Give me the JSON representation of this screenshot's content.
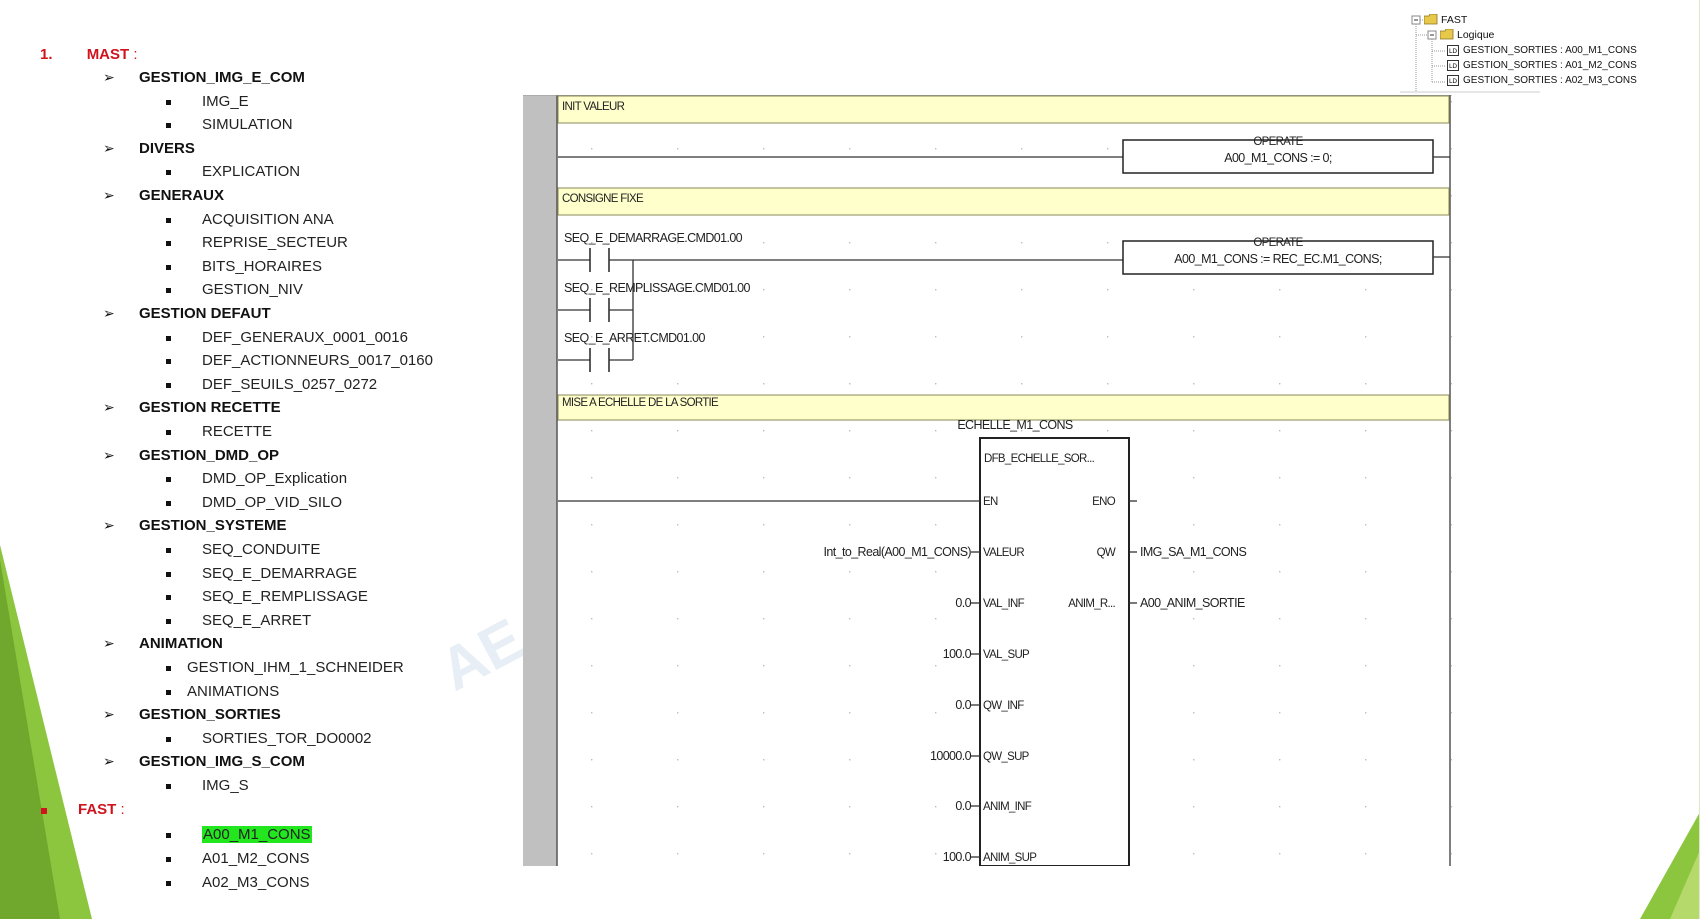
{
  "outline": {
    "mast": {
      "number": "1.",
      "title": "MAST",
      "colon": " :"
    },
    "groups": [
      {
        "name": "GESTION_IMG_E_COM",
        "items": [
          "IMG_E",
          "SIMULATION"
        ]
      },
      {
        "name": "DIVERS",
        "items": [
          "EXPLICATION"
        ]
      },
      {
        "name": "GENERAUX",
        "items": [
          "ACQUISITION ANA",
          "REPRISE_SECTEUR",
          "BITS_HORAIRES",
          "GESTION_NIV"
        ]
      },
      {
        "name": "GESTION DEFAUT",
        "items": [
          "DEF_GENERAUX_0001_0016",
          "DEF_ACTIONNEURS_0017_0160",
          "DEF_SEUILS_0257_0272"
        ]
      },
      {
        "name": "GESTION RECETTE",
        "items": [
          "RECETTE"
        ]
      },
      {
        "name": "GESTION_DMD_OP",
        "items": [
          "DMD_OP_Explication",
          "DMD_OP_VID_SILO"
        ]
      },
      {
        "name": "GESTION_SYSTEME",
        "items": [
          "SEQ_CONDUITE",
          "SEQ_E_DEMARRAGE",
          "SEQ_E_REMPLISSAGE",
          "SEQ_E_ARRET"
        ]
      },
      {
        "name": "ANIMATION",
        "items": [
          "GESTION_IHM_1_SCHNEIDER",
          "ANIMATIONS"
        ]
      },
      {
        "name": "GESTION_SORTIES",
        "items": [
          "SORTIES_TOR_DO0002"
        ]
      },
      {
        "name": "GESTION_IMG_S_COM",
        "items": [
          "IMG_S"
        ]
      }
    ],
    "fast": {
      "title": "FAST",
      "colon": " :",
      "items": [
        "A00_M1_CONS",
        "A01_M2_CONS",
        "A02_M3_CONS"
      ]
    }
  },
  "tree": {
    "root": "FAST",
    "folder": "Logique",
    "items": [
      "GESTION_SORTIES : A00_M1_CONS",
      "GESTION_SORTIES : A01_M2_CONS",
      "GESTION_SORTIES : A02_M3_CONS"
    ]
  },
  "ladder": {
    "comments": [
      "INIT VALEUR",
      "CONSIGNE FIXE",
      "MISE A ECHELLE DE LA SORTIE"
    ],
    "operate_label": "OPERATE",
    "operate1": "A00_M1_CONS := 0;",
    "operate2": "A00_M1_CONS := REC_EC.M1_CONS;",
    "contacts": [
      "SEQ_E_DEMARRAGE.CMD01.00",
      "SEQ_E_REMPLISSAGE.CMD01.00",
      "SEQ_E_ARRET.CMD01.00"
    ],
    "fb_instance": "ECHELLE_M1_CONS",
    "fb_type": "DFB_ECHELLE_SOR...",
    "fb_inputs": [
      "EN",
      "VALEUR",
      "VAL_INF",
      "VAL_SUP",
      "QW_INF",
      "QW_SUP",
      "ANIM_INF",
      "ANIM_SUP"
    ],
    "fb_outputs": [
      "ENO",
      "QW",
      "ANIM_R..."
    ],
    "input_values": [
      "Int_to_Real(A00_M1_CONS)",
      "0.0",
      "100.0",
      "0.0",
      "10000.0",
      "0.0",
      "100.0"
    ],
    "output_values": [
      "IMG_SA_M1_CONS",
      "A00_ANIM_SORTIE"
    ]
  },
  "watermark": "AE",
  "colors": {
    "accent_red": "#d0141e",
    "highlight": "#22e61e",
    "comment_bg": "#ffffcc",
    "deco_green": "#8cc63f"
  }
}
